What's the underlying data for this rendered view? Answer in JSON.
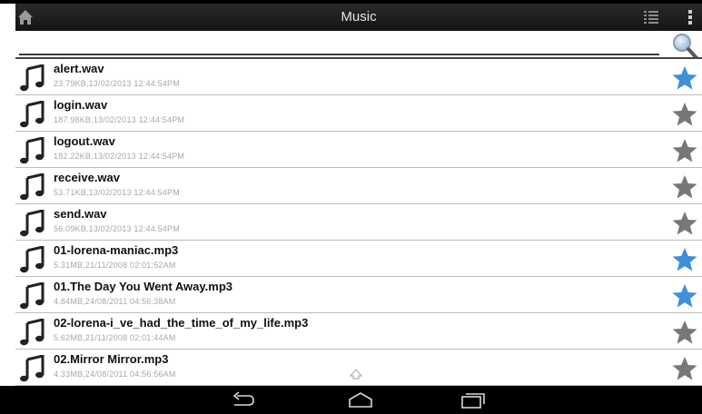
{
  "actionbar": {
    "title": "Music",
    "icons": [
      "home-icon",
      "list-view-icon",
      "overflow-menu-icon"
    ]
  },
  "search": {
    "value": "",
    "placeholder": "",
    "icon": "magnifier-icon"
  },
  "files": [
    {
      "name": "alert.wav",
      "meta": "23.79KB,13/02/2013 12:44:54PM",
      "favorite": true
    },
    {
      "name": "login.wav",
      "meta": "187.98KB,13/02/2013 12:44:54PM",
      "favorite": false
    },
    {
      "name": "logout.wav",
      "meta": "182.22KB,13/02/2013 12:44:54PM",
      "favorite": false
    },
    {
      "name": "receive.wav",
      "meta": "53.71KB,13/02/2013 12:44:54PM",
      "favorite": false
    },
    {
      "name": "send.wav",
      "meta": "56.09KB,13/02/2013 12:44:54PM",
      "favorite": false
    },
    {
      "name": "01-lorena-maniac.mp3",
      "meta": "5.31MB,21/11/2008 02:01:52AM",
      "favorite": true
    },
    {
      "name": "01.The Day You Went Away.mp3",
      "meta": "4.84MB,24/08/2011 04:56:38AM",
      "favorite": true
    },
    {
      "name": "02-lorena-i_ve_had_the_time_of_my_life.mp3",
      "meta": "5.62MB,21/11/2008 02:01:44AM",
      "favorite": false
    },
    {
      "name": "02.Mirror Mirror.mp3",
      "meta": "4.33MB,24/08/2011 04:56:56AM",
      "favorite": false
    }
  ],
  "colors": {
    "star_favorite": "#3f8fd9",
    "star_normal": "#777777",
    "actionbar": "#1c1c1c"
  },
  "navbar": {
    "icons": [
      "back-icon",
      "home-key-icon",
      "recent-apps-icon"
    ]
  }
}
